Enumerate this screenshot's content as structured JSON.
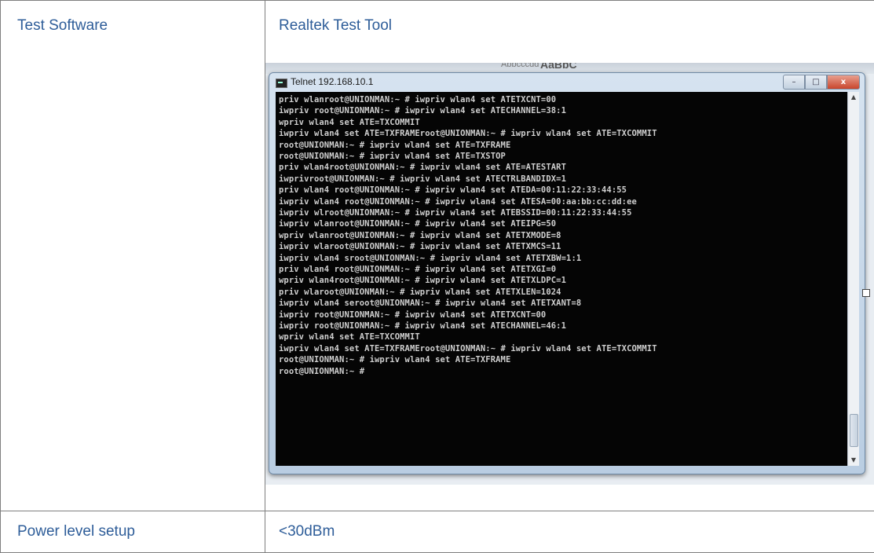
{
  "rows": [
    {
      "label": "Test Software",
      "value": "Realtek Test Tool"
    },
    {
      "label": "Power level setup",
      "value": "<30dBm"
    }
  ],
  "screenshot": {
    "background_text": {
      "small": "Abbcccdd",
      "large": "AaBbC"
    },
    "window": {
      "title": "Telnet 192.168.10.1",
      "buttons": {
        "minimize": "–",
        "maximize": "□",
        "close": "x"
      },
      "terminal_lines": [
        "priv wlanroot@UNIONMAN:~ # iwpriv wlan4 set ATETXCNT=00",
        "iwpriv root@UNIONMAN:~ # iwpriv wlan4 set ATECHANNEL=38:1",
        "wpriv wlan4 set ATE=TXCOMMIT",
        "iwpriv wlan4 set ATE=TXFRAMEroot@UNIONMAN:~ # iwpriv wlan4 set ATE=TXCOMMIT",
        "root@UNIONMAN:~ # iwpriv wlan4 set ATE=TXFRAME",
        "root@UNIONMAN:~ # iwpriv wlan4 set ATE=TXSTOP",
        "priv wlan4root@UNIONMAN:~ # iwpriv wlan4 set ATE=ATESTART",
        "iwprivroot@UNIONMAN:~ # iwpriv wlan4 set ATECTRLBANDIDX=1",
        "priv wlan4 root@UNIONMAN:~ # iwpriv wlan4 set ATEDA=00:11:22:33:44:55",
        "iwpriv wlan4 root@UNIONMAN:~ # iwpriv wlan4 set ATESA=00:aa:bb:cc:dd:ee",
        "iwpriv wlroot@UNIONMAN:~ # iwpriv wlan4 set ATEBSSID=00:11:22:33:44:55",
        "iwpriv wlanroot@UNIONMAN:~ # iwpriv wlan4 set ATEIPG=50",
        "wpriv wlanroot@UNIONMAN:~ # iwpriv wlan4 set ATETXMODE=8",
        "iwpriv wlaroot@UNIONMAN:~ # iwpriv wlan4 set ATETXMCS=11",
        "iwpriv wlan4 sroot@UNIONMAN:~ # iwpriv wlan4 set ATETXBW=1:1",
        "priv wlan4 root@UNIONMAN:~ # iwpriv wlan4 set ATETXGI=0",
        "wpriv wlan4root@UNIONMAN:~ # iwpriv wlan4 set ATETXLDPC=1",
        "priv wlaroot@UNIONMAN:~ # iwpriv wlan4 set ATETXLEN=1024",
        "iwpriv wlan4 seroot@UNIONMAN:~ # iwpriv wlan4 set ATETXANT=8",
        "iwpriv root@UNIONMAN:~ # iwpriv wlan4 set ATETXCNT=00",
        "iwpriv root@UNIONMAN:~ # iwpriv wlan4 set ATECHANNEL=46:1",
        "wpriv wlan4 set ATE=TXCOMMIT",
        "iwpriv wlan4 set ATE=TXFRAMEroot@UNIONMAN:~ # iwpriv wlan4 set ATE=TXCOMMIT",
        "root@UNIONMAN:~ # iwpriv wlan4 set ATE=TXFRAME",
        "root@UNIONMAN:~ #"
      ],
      "scrollbar": {
        "up": "▲",
        "down": "▼"
      }
    }
  }
}
